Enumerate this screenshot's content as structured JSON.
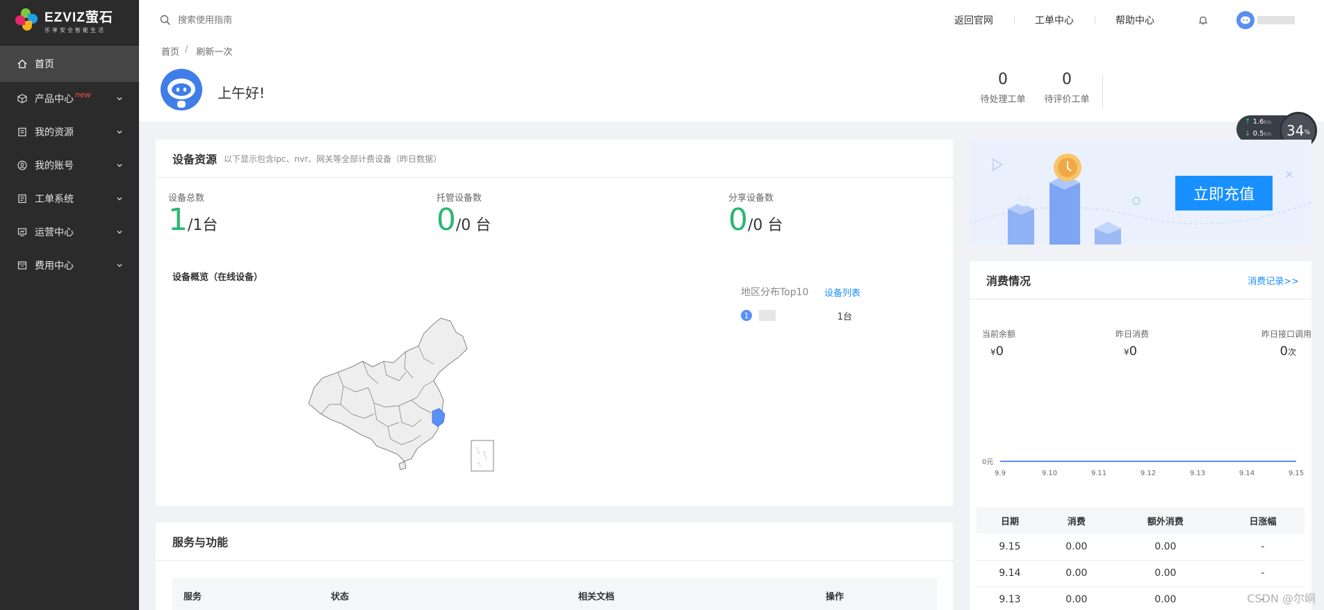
{
  "sidebar": {
    "brand": "EZVIZ萤石",
    "tagline": "乐享安全智能生活",
    "items": [
      {
        "label": "首页",
        "icon": "home-icon"
      },
      {
        "label": "产品中心",
        "badge": "new",
        "icon": "package-icon"
      },
      {
        "label": "我的资源",
        "icon": "resource-icon"
      },
      {
        "label": "我的账号",
        "icon": "account-icon"
      },
      {
        "label": "工单系统",
        "icon": "ticket-icon"
      },
      {
        "label": "运营中心",
        "icon": "operation-icon"
      },
      {
        "label": "费用中心",
        "icon": "billing-icon"
      }
    ]
  },
  "header": {
    "search_placeholder": "搜索使用指南",
    "links": [
      "返回官网",
      "工单中心",
      "帮助中心"
    ]
  },
  "welcome": {
    "breadcrumb": [
      "首页",
      "刷新一次"
    ],
    "greeting": "上午好!",
    "pending_tickets": {
      "value": "0",
      "label": "待处理工单"
    },
    "pending_reviews": {
      "value": "0",
      "label": "待评价工单"
    }
  },
  "network": {
    "up": "1.6",
    "down": "0.5",
    "unit": "K/s",
    "percent": "34",
    "percent_unit": "%"
  },
  "devices": {
    "title": "设备资源",
    "subtitle": "以下显示包含ipc、nvr、网关等全部计费设备（昨日数据）",
    "total": {
      "label": "设备总数",
      "big": "1",
      "rest": "/1台"
    },
    "hosted": {
      "label": "托管设备数",
      "big": "0",
      "rest": "/0 台"
    },
    "shared": {
      "label": "分享设备数",
      "big": "0",
      "rest": "/0 台"
    },
    "overview_title": "设备概览（在线设备）",
    "region_title": "地区分布Top10",
    "device_list_link": "设备列表",
    "ranking": [
      {
        "rank": "1",
        "value": "1台"
      }
    ]
  },
  "promo": {
    "button": "立即充值"
  },
  "consumption": {
    "title": "消费情况",
    "link": "消费记录>>",
    "balance": {
      "label": "当前余额",
      "prefix": "¥",
      "value": "0"
    },
    "yesterday": {
      "label": "昨日消费",
      "prefix": "¥",
      "value": "0"
    },
    "api_calls": {
      "label": "昨日接口调用",
      "value": "0",
      "unit": "次"
    },
    "table": {
      "headers": [
        "日期",
        "消费",
        "额外消费",
        "日涨幅"
      ],
      "rows": [
        [
          "9.15",
          "0.00",
          "0.00",
          "-"
        ],
        [
          "9.14",
          "0.00",
          "0.00",
          "-"
        ],
        [
          "9.13",
          "0.00",
          "0.00",
          "-"
        ]
      ]
    }
  },
  "chart_data": {
    "type": "line",
    "x": [
      "9.9",
      "9.10",
      "9.11",
      "9.12",
      "9.13",
      "9.14",
      "9.15"
    ],
    "series": [
      {
        "values": [
          0,
          0,
          0,
          0,
          0,
          0,
          0
        ]
      }
    ],
    "y_tick_labels": [
      "0元"
    ],
    "title": "",
    "color": "#5b8ff9"
  },
  "services": {
    "title": "服务与功能",
    "headers": [
      "服务",
      "状态",
      "相关文档",
      "操作"
    ]
  },
  "watermark": "CSDN @尔峒",
  "colors": {
    "accent": "#1890ff",
    "green": "#2bb673",
    "sidebar": "#2b2b2b"
  }
}
